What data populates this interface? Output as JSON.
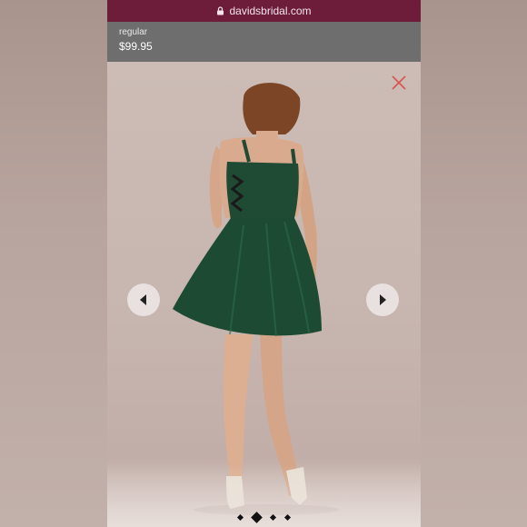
{
  "browser": {
    "url": "davidsbridal.com"
  },
  "product": {
    "price_label": "regular",
    "price": "$99.95"
  },
  "gallery": {
    "image_alt": "Back view of model wearing a short green satin fit-and-flare dress with cutouts",
    "active_slide_index": 1,
    "slide_count": 4
  },
  "colors": {
    "url_bar": "#6d1d3a",
    "price_header": "#6f6e6e",
    "close_icon": "#d9534f",
    "dress": "#1f4a33"
  }
}
